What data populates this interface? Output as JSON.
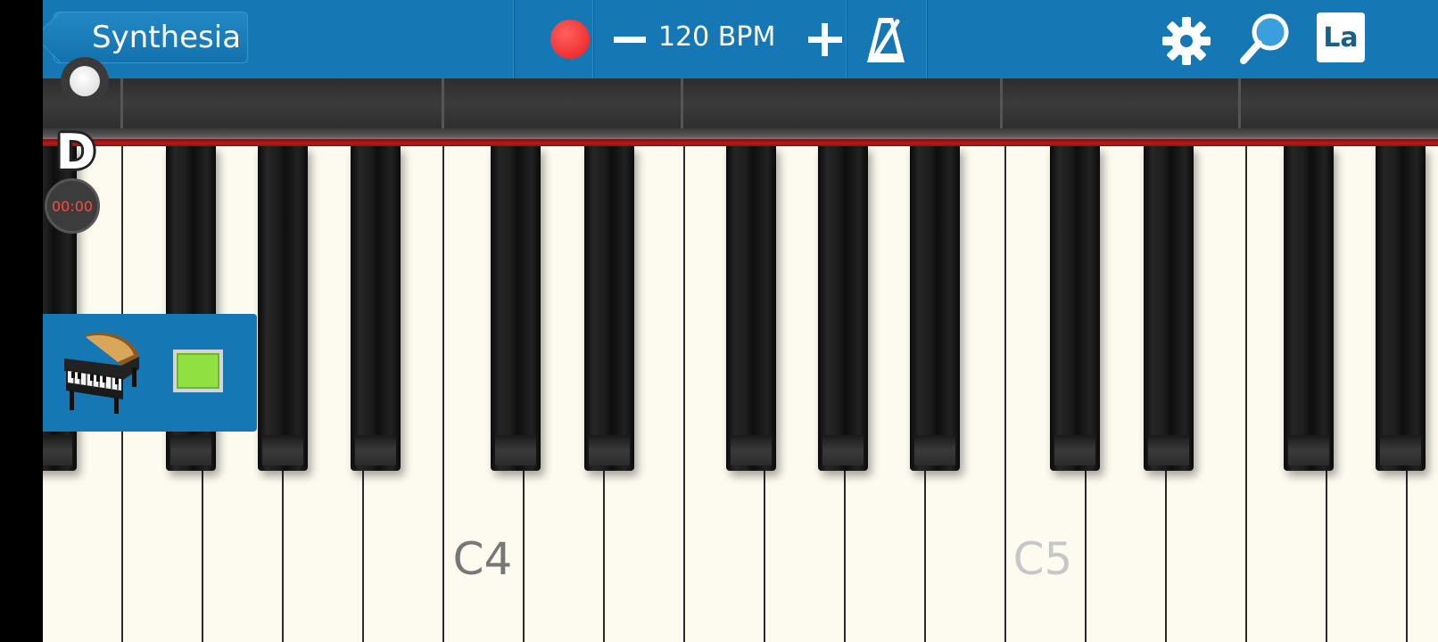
{
  "toolbar": {
    "back_label": "Synthesia",
    "tempo_label": "120 BPM",
    "lang_label": "La",
    "colors": {
      "bar": "#1578b4",
      "record": "#f03030"
    }
  },
  "icons": [
    "back-arrow-icon",
    "record-icon",
    "minus-icon",
    "plus-icon",
    "metronome-icon",
    "gear-icon",
    "magnifier-icon",
    "grand-piano-icon"
  ],
  "overlay": {
    "difficulty": "D",
    "timer": "00:00",
    "track_color": "#8fe040"
  },
  "keyboard": {
    "labels": {
      "c4": "C4",
      "c5": "C5"
    }
  }
}
